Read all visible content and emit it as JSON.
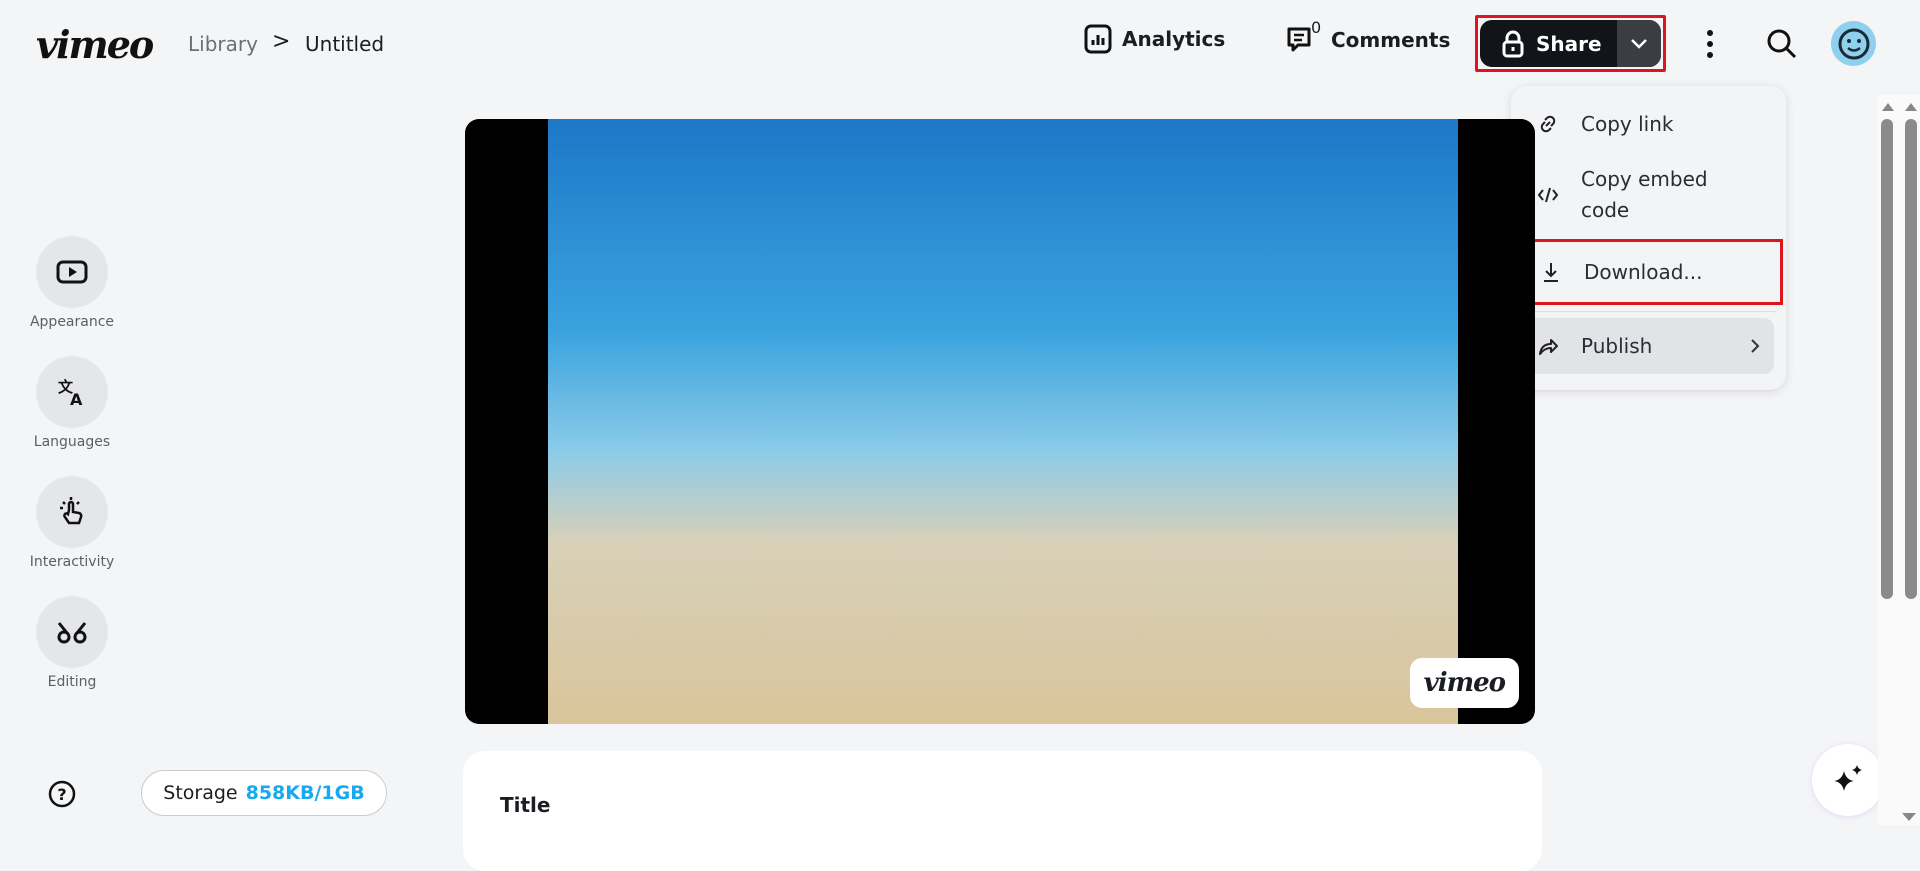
{
  "header": {
    "logo": "vimeo",
    "breadcrumb": [
      "Library",
      "Untitled"
    ],
    "analytics": "Analytics",
    "comments": "Comments",
    "comments_count": "0",
    "share": "Share"
  },
  "share_menu": {
    "items": [
      {
        "label": "Copy link",
        "icon": "link-icon"
      },
      {
        "label": "Copy embed code",
        "icon": "code-icon"
      },
      {
        "label": "Download...",
        "icon": "download-icon"
      },
      {
        "label": "Publish",
        "icon": "share-arrow-icon"
      }
    ]
  },
  "sidebar": {
    "items": [
      {
        "label": "Appearance"
      },
      {
        "label": "Languages"
      },
      {
        "label": "Interactivity"
      },
      {
        "label": "Editing"
      }
    ]
  },
  "video": {
    "watermark": "vimeo"
  },
  "storage": {
    "label": "Storage",
    "value": "858KB/1GB"
  },
  "details": {
    "title_label": "Title"
  },
  "colors": {
    "accent": "#17a9f0",
    "highlight": "#e0141e"
  }
}
